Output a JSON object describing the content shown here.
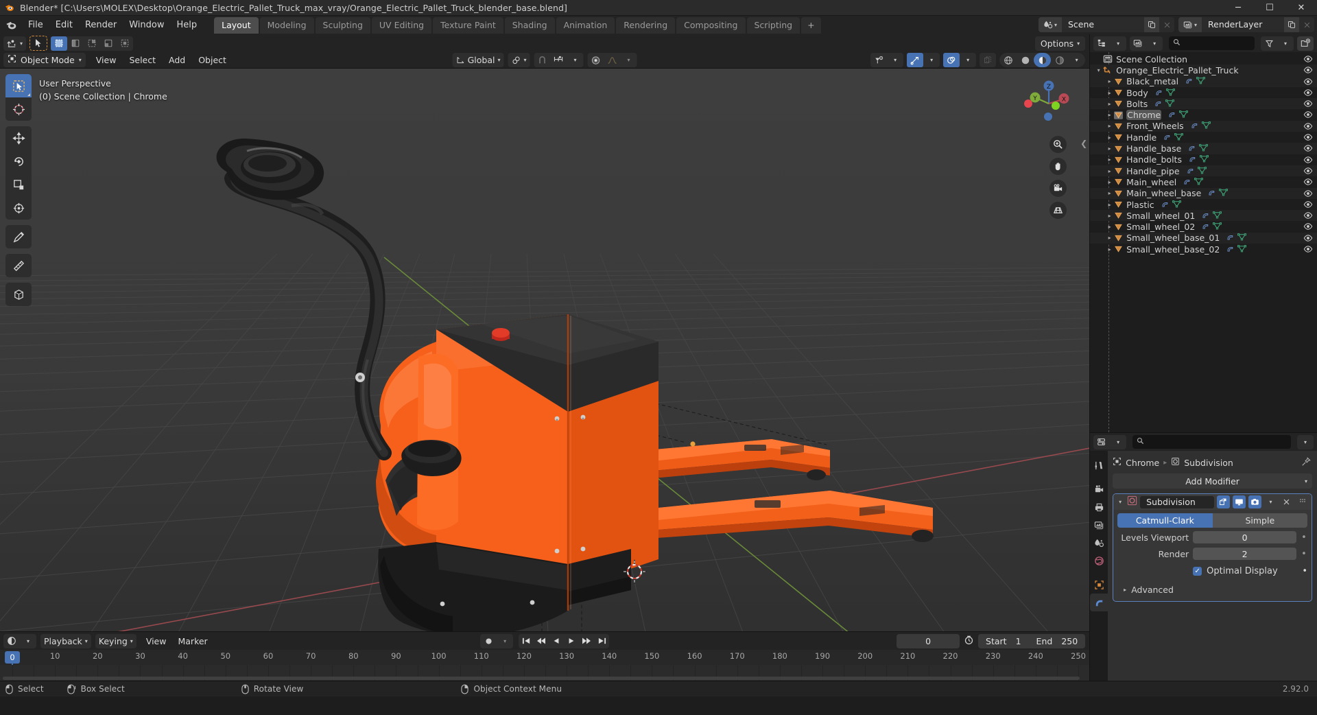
{
  "window": {
    "title": "Blender* [C:\\Users\\MOLEX\\Desktop\\Orange_Electric_Pallet_Truck_max_vray/Orange_Electric_Pallet_Truck_blender_base.blend]",
    "minimize": "─",
    "maximize": "☐",
    "close": "✕"
  },
  "topbar": {
    "menus": [
      "File",
      "Edit",
      "Render",
      "Window",
      "Help"
    ],
    "workspaces": [
      {
        "label": "Layout",
        "active": true
      },
      {
        "label": "Modeling",
        "active": false
      },
      {
        "label": "Sculpting",
        "active": false
      },
      {
        "label": "UV Editing",
        "active": false
      },
      {
        "label": "Texture Paint",
        "active": false
      },
      {
        "label": "Shading",
        "active": false
      },
      {
        "label": "Animation",
        "active": false
      },
      {
        "label": "Rendering",
        "active": false
      },
      {
        "label": "Compositing",
        "active": false
      },
      {
        "label": "Scripting",
        "active": false
      }
    ],
    "add_workspace": "+",
    "scene": {
      "name": "Scene",
      "icon": "scene-icon"
    },
    "view_layer": {
      "name": "RenderLayer",
      "icon": "view-layer-icon"
    }
  },
  "viewport_header": {
    "mode": "Object Mode",
    "menus": [
      "View",
      "Select",
      "Add",
      "Object"
    ],
    "transform_orientation": "Global",
    "options_label": "Options"
  },
  "viewport": {
    "perspective_label": "User Perspective",
    "collection_label": "(0) Scene Collection | Chrome",
    "gizmo_axes": [
      {
        "label": "Z",
        "color": "#4772b3"
      },
      {
        "label": "Y",
        "color": "#7fab3a"
      },
      {
        "label": "X",
        "color": "#b94a55"
      }
    ],
    "nav_buttons": [
      "zoom-icon",
      "hand-icon",
      "camera-icon",
      "grid-icon"
    ]
  },
  "timeline": {
    "menus": [
      "View",
      "Marker"
    ],
    "playback_label": "Playback",
    "keying_label": "Keying",
    "current_frame": "0",
    "start_label": "Start",
    "start_value": "1",
    "end_label": "End",
    "end_value": "250",
    "ticks": [
      "0",
      "10",
      "20",
      "30",
      "40",
      "50",
      "60",
      "70",
      "80",
      "90",
      "100",
      "110",
      "120",
      "130",
      "140",
      "150",
      "160",
      "170",
      "180",
      "190",
      "200",
      "210",
      "220",
      "230",
      "240",
      "250"
    ],
    "playhead_label": "0"
  },
  "outliner": {
    "search_placeholder": "",
    "scene_collection": "Scene Collection",
    "root_object": "Orange_Electric_Pallet_Truck",
    "items": [
      {
        "name": "Black_metal",
        "selected": false
      },
      {
        "name": "Body",
        "selected": false
      },
      {
        "name": "Bolts",
        "selected": false
      },
      {
        "name": "Chrome",
        "selected": true
      },
      {
        "name": "Front_Wheels",
        "selected": false
      },
      {
        "name": "Handle",
        "selected": false
      },
      {
        "name": "Handle_base",
        "selected": false
      },
      {
        "name": "Handle_bolts",
        "selected": false
      },
      {
        "name": "Handle_pipe",
        "selected": false
      },
      {
        "name": "Main_wheel",
        "selected": false
      },
      {
        "name": "Main_wheel_base",
        "selected": false
      },
      {
        "name": "Plastic",
        "selected": false
      },
      {
        "name": "Small_wheel_01",
        "selected": false
      },
      {
        "name": "Small_wheel_02",
        "selected": false
      },
      {
        "name": "Small_wheel_base_01",
        "selected": false
      },
      {
        "name": "Small_wheel_base_02",
        "selected": false
      }
    ]
  },
  "properties": {
    "search_placeholder": "",
    "breadcrumb_object": "Chrome",
    "breadcrumb_modifier": "Subdivision",
    "add_modifier_label": "Add Modifier",
    "modifier": {
      "name": "Subdivision",
      "type_catmull": "Catmull-Clark",
      "type_simple": "Simple",
      "levels_viewport_label": "Levels Viewport",
      "levels_viewport_value": "0",
      "render_label": "Render",
      "render_value": "2",
      "optimal_display_label": "Optimal Display",
      "optimal_display_checked": true,
      "advanced_label": "Advanced"
    }
  },
  "statusbar": {
    "items": [
      {
        "label": "Select",
        "icon": "mouse-left-icon"
      },
      {
        "label": "Box Select",
        "icon": "mouse-left-drag-icon"
      },
      {
        "label": "Rotate View",
        "icon": "mouse-middle-icon"
      },
      {
        "label": "Object Context Menu",
        "icon": "mouse-right-icon"
      }
    ],
    "version": "2.92.0"
  },
  "colors": {
    "accent_blue": "#4772b3",
    "orange": "#ff6a13",
    "axis_x": "#b94a55",
    "axis_y": "#7fab3a",
    "axis_z": "#4772b3",
    "bg_dark": "#1d1d1d",
    "header": "#232323"
  }
}
